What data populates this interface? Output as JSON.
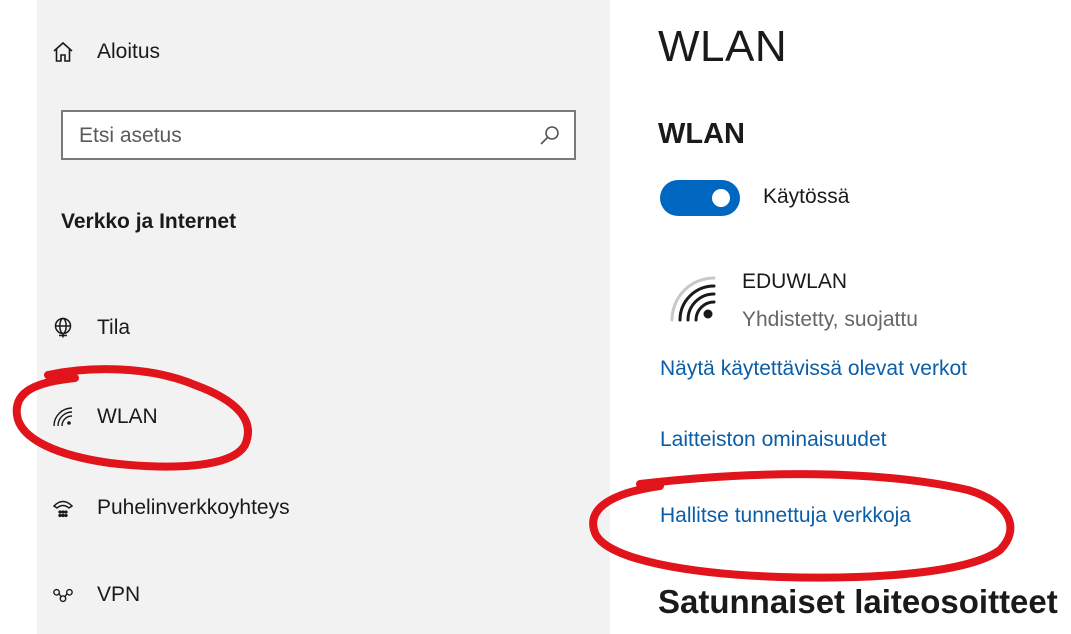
{
  "sidebar": {
    "home_label": "Aloitus",
    "search_placeholder": "Etsi asetus",
    "section_heading": "Verkko ja Internet",
    "items": [
      {
        "label": "Tila",
        "icon": "globe-icon"
      },
      {
        "label": "WLAN",
        "icon": "wifi-icon"
      },
      {
        "label": "Puhelinverkkoyhteys",
        "icon": "dialup-icon"
      },
      {
        "label": "VPN",
        "icon": "vpn-icon"
      }
    ]
  },
  "main": {
    "title": "WLAN",
    "subtitle": "WLAN",
    "toggle": {
      "label": "Käytössä",
      "on": true
    },
    "network": {
      "name": "EDUWLAN",
      "status": "Yhdistetty, suojattu"
    },
    "links": {
      "show_networks": "Näytä käytettävissä olevat verkot",
      "hardware": "Laitteiston ominaisuudet",
      "manage_known": "Hallitse tunnettuja verkkoja"
    },
    "random_heading": "Satunnaiset laiteosoitteet"
  },
  "colors": {
    "accent": "#0067c0",
    "link": "#0a5ea8",
    "sidebar_bg": "#f2f2f2",
    "annotation": "#e0141a"
  }
}
